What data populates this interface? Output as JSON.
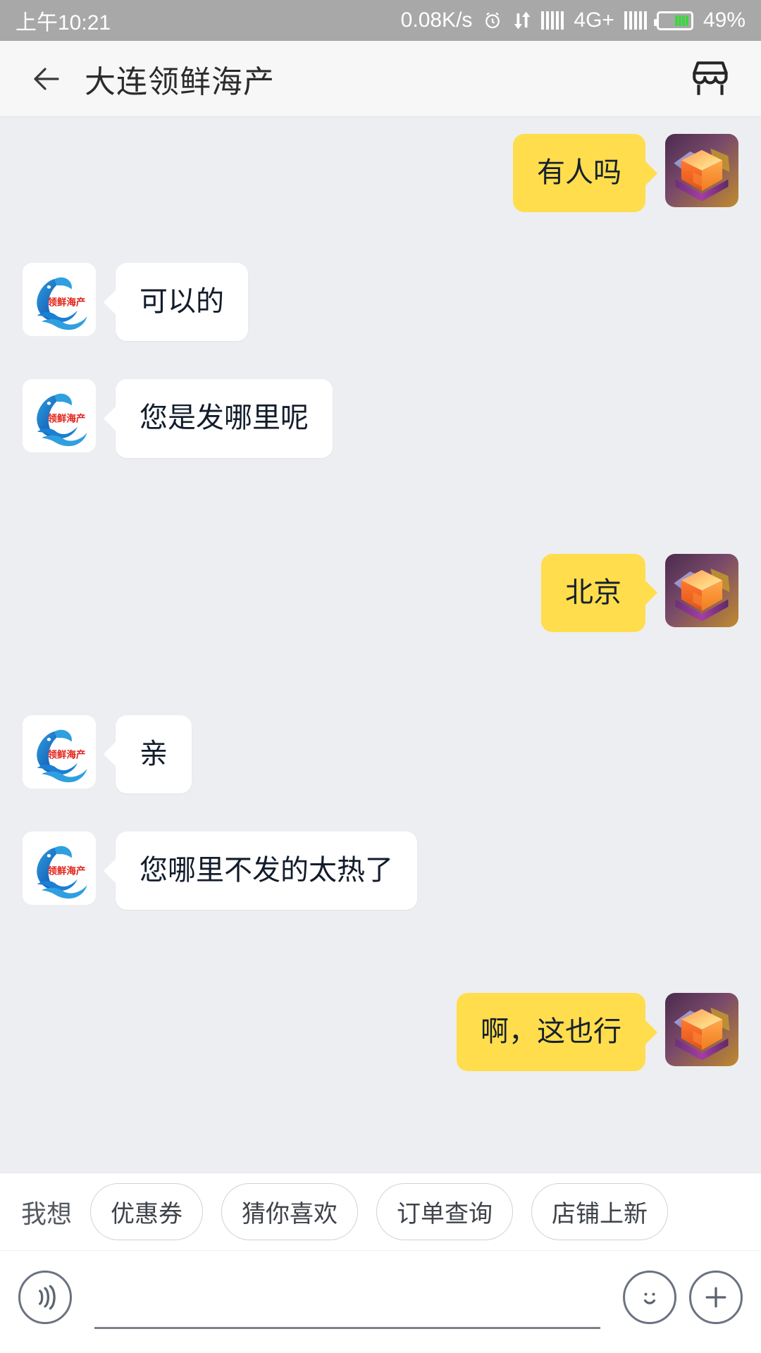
{
  "statusbar": {
    "time": "上午10:21",
    "net_speed": "0.08K/s",
    "alarm_icon": "alarm-icon",
    "data_transfer_icon": "data-transfer-icon",
    "signal_icon": "signal-bars-icon",
    "network_type": "4G+",
    "signal2_icon": "signal-bars-icon",
    "battery_icon": "battery-icon",
    "battery_percent": "49%",
    "bg_color": "#a8a8a8",
    "battery_fill_color": "#3ed641"
  },
  "header": {
    "back_icon": "back-arrow-icon",
    "title": "大连领鲜海产",
    "shop_icon": "shop-icon",
    "bg_color": "#f7f7f8"
  },
  "chat": {
    "bg_color": "#eceef1",
    "me_bubble_color": "#ffdd4c",
    "shop_bubble_color": "#ffffff",
    "shop_avatar_name": "shop-avatar-lingxian-seafood",
    "me_avatar_name": "user-avatar-cube",
    "messages": [
      {
        "sender": "me",
        "text": "有人吗"
      },
      {
        "sender": "shop",
        "text": "可以的"
      },
      {
        "sender": "shop",
        "text": "您是发哪里呢"
      },
      {
        "sender": "me",
        "text": "北京"
      },
      {
        "sender": "shop",
        "text": "亲"
      },
      {
        "sender": "shop",
        "text": "您哪里不发的太热了"
      },
      {
        "sender": "me",
        "text": "啊，这也行"
      }
    ]
  },
  "quick_replies": {
    "label": "我想",
    "chips": [
      "优惠券",
      "猜你喜欢",
      "订单查询",
      "店铺上新"
    ]
  },
  "input_bar": {
    "voice_icon": "voice-wave-icon",
    "placeholder": "",
    "value": "",
    "emoji_icon": "emoji-smiley-icon",
    "plus_icon": "plus-icon"
  },
  "shop_logo": {
    "text": "领鲜海产",
    "text_color": "#e2231a"
  }
}
